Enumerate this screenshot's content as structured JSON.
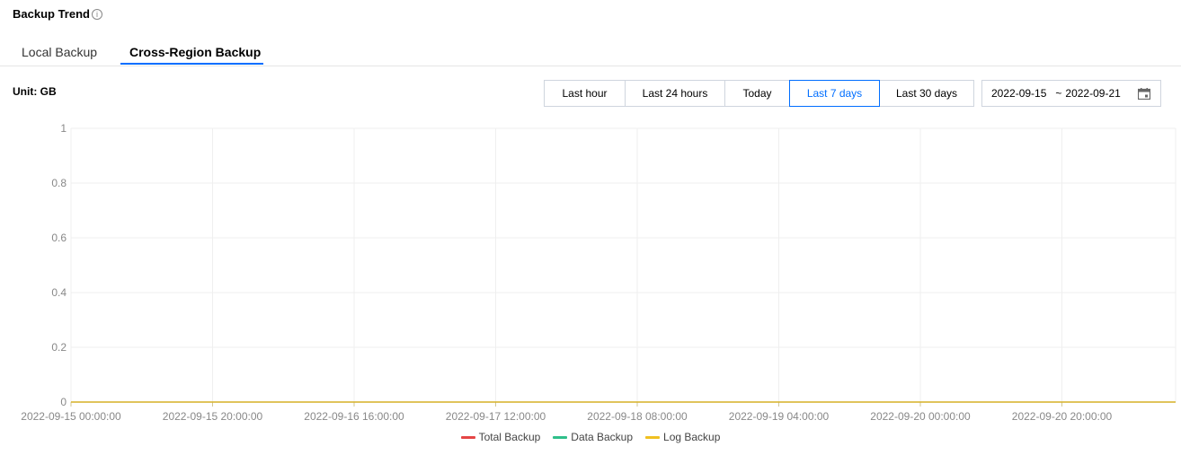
{
  "header": {
    "title": "Backup Trend",
    "info_icon": "info-icon"
  },
  "tabs": [
    {
      "label": "Local Backup",
      "active": false
    },
    {
      "label": "Cross-Region Backup",
      "active": true
    }
  ],
  "unit_label": "Unit: GB",
  "time_range": {
    "options": [
      "Last hour",
      "Last 24 hours",
      "Today",
      "Last 7 days",
      "Last 30 days"
    ],
    "selected": "Last 7 days"
  },
  "date_range": {
    "start": "2022-09-15",
    "separator": "~",
    "end": "2022-09-21",
    "icon": "calendar-icon"
  },
  "colors": {
    "accent": "#006eff",
    "total": "#e54545",
    "data": "#2fbf8a",
    "log": "#f0c020"
  },
  "chart_data": {
    "type": "line",
    "x": [
      "2022-09-15 00:00:00",
      "2022-09-15 20:00:00",
      "2022-09-16 16:00:00",
      "2022-09-17 12:00:00",
      "2022-09-18 08:00:00",
      "2022-09-19 04:00:00",
      "2022-09-20 00:00:00",
      "2022-09-20 20:00:00"
    ],
    "ylim": [
      0,
      1
    ],
    "yticks": [
      "0",
      "0.2",
      "0.4",
      "0.6",
      "0.8",
      "1"
    ],
    "grid": true,
    "legend_position": "bottom",
    "series": [
      {
        "name": "Total Backup",
        "color": "#e54545",
        "values": [
          0,
          0,
          0,
          0,
          0,
          0,
          0,
          0
        ]
      },
      {
        "name": "Data Backup",
        "color": "#2fbf8a",
        "values": [
          0,
          0,
          0,
          0,
          0,
          0,
          0,
          0
        ]
      },
      {
        "name": "Log Backup",
        "color": "#f0c020",
        "values": [
          0,
          0,
          0,
          0,
          0,
          0,
          0,
          0
        ]
      }
    ]
  }
}
